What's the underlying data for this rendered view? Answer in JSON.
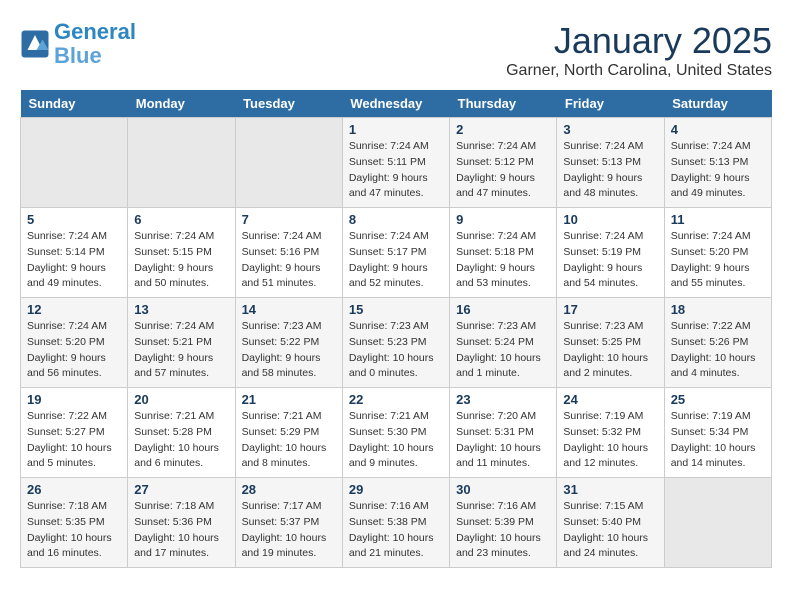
{
  "header": {
    "logo_line1": "General",
    "logo_line2": "Blue",
    "month_title": "January 2025",
    "location": "Garner, North Carolina, United States"
  },
  "days_of_week": [
    "Sunday",
    "Monday",
    "Tuesday",
    "Wednesday",
    "Thursday",
    "Friday",
    "Saturday"
  ],
  "weeks": [
    [
      {
        "day": "",
        "empty": true
      },
      {
        "day": "",
        "empty": true
      },
      {
        "day": "",
        "empty": true
      },
      {
        "day": "1",
        "sunrise": "7:24 AM",
        "sunset": "5:11 PM",
        "daylight": "9 hours and 47 minutes."
      },
      {
        "day": "2",
        "sunrise": "7:24 AM",
        "sunset": "5:12 PM",
        "daylight": "9 hours and 47 minutes."
      },
      {
        "day": "3",
        "sunrise": "7:24 AM",
        "sunset": "5:13 PM",
        "daylight": "9 hours and 48 minutes."
      },
      {
        "day": "4",
        "sunrise": "7:24 AM",
        "sunset": "5:13 PM",
        "daylight": "9 hours and 49 minutes."
      }
    ],
    [
      {
        "day": "5",
        "sunrise": "7:24 AM",
        "sunset": "5:14 PM",
        "daylight": "9 hours and 49 minutes."
      },
      {
        "day": "6",
        "sunrise": "7:24 AM",
        "sunset": "5:15 PM",
        "daylight": "9 hours and 50 minutes."
      },
      {
        "day": "7",
        "sunrise": "7:24 AM",
        "sunset": "5:16 PM",
        "daylight": "9 hours and 51 minutes."
      },
      {
        "day": "8",
        "sunrise": "7:24 AM",
        "sunset": "5:17 PM",
        "daylight": "9 hours and 52 minutes."
      },
      {
        "day": "9",
        "sunrise": "7:24 AM",
        "sunset": "5:18 PM",
        "daylight": "9 hours and 53 minutes."
      },
      {
        "day": "10",
        "sunrise": "7:24 AM",
        "sunset": "5:19 PM",
        "daylight": "9 hours and 54 minutes."
      },
      {
        "day": "11",
        "sunrise": "7:24 AM",
        "sunset": "5:20 PM",
        "daylight": "9 hours and 55 minutes."
      }
    ],
    [
      {
        "day": "12",
        "sunrise": "7:24 AM",
        "sunset": "5:20 PM",
        "daylight": "9 hours and 56 minutes."
      },
      {
        "day": "13",
        "sunrise": "7:24 AM",
        "sunset": "5:21 PM",
        "daylight": "9 hours and 57 minutes."
      },
      {
        "day": "14",
        "sunrise": "7:23 AM",
        "sunset": "5:22 PM",
        "daylight": "9 hours and 58 minutes."
      },
      {
        "day": "15",
        "sunrise": "7:23 AM",
        "sunset": "5:23 PM",
        "daylight": "10 hours and 0 minutes."
      },
      {
        "day": "16",
        "sunrise": "7:23 AM",
        "sunset": "5:24 PM",
        "daylight": "10 hours and 1 minute."
      },
      {
        "day": "17",
        "sunrise": "7:23 AM",
        "sunset": "5:25 PM",
        "daylight": "10 hours and 2 minutes."
      },
      {
        "day": "18",
        "sunrise": "7:22 AM",
        "sunset": "5:26 PM",
        "daylight": "10 hours and 4 minutes."
      }
    ],
    [
      {
        "day": "19",
        "sunrise": "7:22 AM",
        "sunset": "5:27 PM",
        "daylight": "10 hours and 5 minutes."
      },
      {
        "day": "20",
        "sunrise": "7:21 AM",
        "sunset": "5:28 PM",
        "daylight": "10 hours and 6 minutes."
      },
      {
        "day": "21",
        "sunrise": "7:21 AM",
        "sunset": "5:29 PM",
        "daylight": "10 hours and 8 minutes."
      },
      {
        "day": "22",
        "sunrise": "7:21 AM",
        "sunset": "5:30 PM",
        "daylight": "10 hours and 9 minutes."
      },
      {
        "day": "23",
        "sunrise": "7:20 AM",
        "sunset": "5:31 PM",
        "daylight": "10 hours and 11 minutes."
      },
      {
        "day": "24",
        "sunrise": "7:19 AM",
        "sunset": "5:32 PM",
        "daylight": "10 hours and 12 minutes."
      },
      {
        "day": "25",
        "sunrise": "7:19 AM",
        "sunset": "5:34 PM",
        "daylight": "10 hours and 14 minutes."
      }
    ],
    [
      {
        "day": "26",
        "sunrise": "7:18 AM",
        "sunset": "5:35 PM",
        "daylight": "10 hours and 16 minutes."
      },
      {
        "day": "27",
        "sunrise": "7:18 AM",
        "sunset": "5:36 PM",
        "daylight": "10 hours and 17 minutes."
      },
      {
        "day": "28",
        "sunrise": "7:17 AM",
        "sunset": "5:37 PM",
        "daylight": "10 hours and 19 minutes."
      },
      {
        "day": "29",
        "sunrise": "7:16 AM",
        "sunset": "5:38 PM",
        "daylight": "10 hours and 21 minutes."
      },
      {
        "day": "30",
        "sunrise": "7:16 AM",
        "sunset": "5:39 PM",
        "daylight": "10 hours and 23 minutes."
      },
      {
        "day": "31",
        "sunrise": "7:15 AM",
        "sunset": "5:40 PM",
        "daylight": "10 hours and 24 minutes."
      },
      {
        "day": "",
        "empty": true
      }
    ]
  ]
}
